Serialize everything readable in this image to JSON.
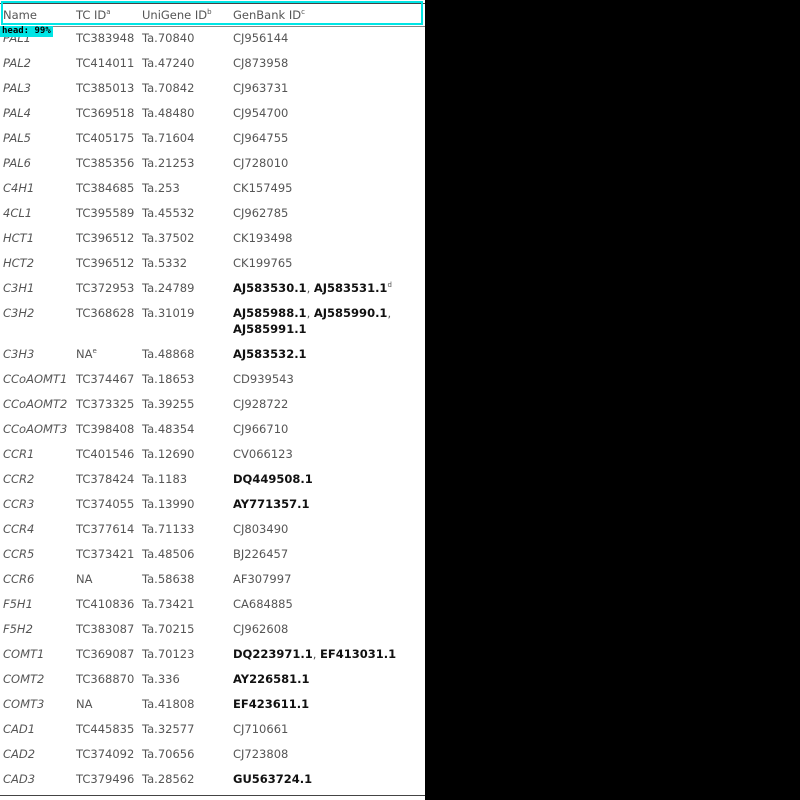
{
  "overlay": {
    "label": "head: 99%"
  },
  "header": {
    "name": "Name",
    "tc": "TC ID",
    "tc_sup": "a",
    "unigene": "UniGene ID",
    "unigene_sup": "b",
    "genbank": "GenBank ID",
    "genbank_sup": "c"
  },
  "rows": [
    {
      "name": "PAL1",
      "tc": "TC383948",
      "unigene": "Ta.70840",
      "genbank": [
        {
          "text": "CJ956144",
          "bold": false
        }
      ]
    },
    {
      "name": "PAL2",
      "tc": "TC414011",
      "unigene": "Ta.47240",
      "genbank": [
        {
          "text": "CJ873958",
          "bold": false
        }
      ]
    },
    {
      "name": "PAL3",
      "tc": "TC385013",
      "unigene": "Ta.70842",
      "genbank": [
        {
          "text": "CJ963731",
          "bold": false
        }
      ]
    },
    {
      "name": "PAL4",
      "tc": "TC369518",
      "unigene": "Ta.48480",
      "genbank": [
        {
          "text": "CJ954700",
          "bold": false
        }
      ]
    },
    {
      "name": "PAL5",
      "tc": "TC405175",
      "unigene": "Ta.71604",
      "genbank": [
        {
          "text": "CJ964755",
          "bold": false
        }
      ]
    },
    {
      "name": "PAL6",
      "tc": "TC385356",
      "unigene": "Ta.21253",
      "genbank": [
        {
          "text": "CJ728010",
          "bold": false
        }
      ]
    },
    {
      "name": "C4H1",
      "tc": "TC384685",
      "unigene": "Ta.253",
      "genbank": [
        {
          "text": "CK157495",
          "bold": false
        }
      ]
    },
    {
      "name": "4CL1",
      "tc": "TC395589",
      "unigene": "Ta.45532",
      "genbank": [
        {
          "text": "CJ962785",
          "bold": false
        }
      ]
    },
    {
      "name": "HCT1",
      "tc": "TC396512",
      "unigene": "Ta.37502",
      "genbank": [
        {
          "text": "CK193498",
          "bold": false
        }
      ]
    },
    {
      "name": "HCT2",
      "tc": "TC396512",
      "unigene": "Ta.5332",
      "genbank": [
        {
          "text": "CK199765",
          "bold": false
        }
      ]
    },
    {
      "name": "C3H1",
      "tc": "TC372953",
      "unigene": "Ta.24789",
      "genbank": [
        {
          "text": "AJ583530.1",
          "bold": true
        },
        {
          "text": ", ",
          "bold": false
        },
        {
          "text": "AJ583531.1",
          "bold": true
        }
      ],
      "genbank_sup": "d"
    },
    {
      "name": "C3H2",
      "tc": "TC368628",
      "unigene": "Ta.31019",
      "genbank": [
        {
          "text": "AJ585988.1",
          "bold": true
        },
        {
          "text": ", ",
          "bold": false
        },
        {
          "text": "AJ585990.1",
          "bold": true
        },
        {
          "text": ",",
          "bold": false
        }
      ],
      "genbank_line2": [
        {
          "text": "AJ585991.1",
          "bold": true
        }
      ]
    },
    {
      "name": "C3H3",
      "tc": "NA",
      "tc_sup": "e",
      "unigene": "Ta.48868",
      "genbank": [
        {
          "text": "AJ583532.1",
          "bold": true
        }
      ]
    },
    {
      "name": "CCoAOMT1",
      "tc": "TC374467",
      "unigene": "Ta.18653",
      "genbank": [
        {
          "text": "CD939543",
          "bold": false
        }
      ]
    },
    {
      "name": "CCoAOMT2",
      "tc": "TC373325",
      "unigene": "Ta.39255",
      "genbank": [
        {
          "text": "CJ928722",
          "bold": false
        }
      ]
    },
    {
      "name": "CCoAOMT3",
      "tc": "TC398408",
      "unigene": "Ta.48354",
      "genbank": [
        {
          "text": "CJ966710",
          "bold": false
        }
      ]
    },
    {
      "name": "CCR1",
      "tc": "TC401546",
      "unigene": "Ta.12690",
      "genbank": [
        {
          "text": "CV066123",
          "bold": false
        }
      ]
    },
    {
      "name": "CCR2",
      "tc": "TC378424",
      "unigene": "Ta.1183",
      "genbank": [
        {
          "text": "DQ449508.1",
          "bold": true
        }
      ]
    },
    {
      "name": "CCR3",
      "tc": "TC374055",
      "unigene": "Ta.13990",
      "genbank": [
        {
          "text": "AY771357.1",
          "bold": true
        }
      ]
    },
    {
      "name": "CCR4",
      "tc": "TC377614",
      "unigene": "Ta.71133",
      "genbank": [
        {
          "text": "CJ803490",
          "bold": false
        }
      ]
    },
    {
      "name": "CCR5",
      "tc": "TC373421",
      "unigene": "Ta.48506",
      "genbank": [
        {
          "text": "BJ226457",
          "bold": false
        }
      ]
    },
    {
      "name": "CCR6",
      "tc": "NA",
      "unigene": "Ta.58638",
      "genbank": [
        {
          "text": "AF307997",
          "bold": false
        }
      ]
    },
    {
      "name": "F5H1",
      "tc": "TC410836",
      "unigene": "Ta.73421",
      "genbank": [
        {
          "text": "CA684885",
          "bold": false
        }
      ]
    },
    {
      "name": "F5H2",
      "tc": "TC383087",
      "unigene": "Ta.70215",
      "genbank": [
        {
          "text": "CJ962608",
          "bold": false
        }
      ]
    },
    {
      "name": "COMT1",
      "tc": "TC369087",
      "unigene": "Ta.70123",
      "genbank": [
        {
          "text": "DQ223971.1",
          "bold": true
        },
        {
          "text": ", ",
          "bold": false
        },
        {
          "text": "EF413031.1",
          "bold": true
        }
      ]
    },
    {
      "name": "COMT2",
      "tc": "TC368870",
      "unigene": "Ta.336",
      "genbank": [
        {
          "text": "AY226581.1",
          "bold": true
        }
      ]
    },
    {
      "name": "COMT3",
      "tc": "NA",
      "unigene": "Ta.41808",
      "genbank": [
        {
          "text": "EF423611.1",
          "bold": true
        }
      ]
    },
    {
      "name": "CAD1",
      "tc": "TC445835",
      "unigene": "Ta.32577",
      "genbank": [
        {
          "text": "CJ710661",
          "bold": false
        }
      ]
    },
    {
      "name": "CAD2",
      "tc": "TC374092",
      "unigene": "Ta.70656",
      "genbank": [
        {
          "text": "CJ723808",
          "bold": false
        }
      ]
    },
    {
      "name": "CAD3",
      "tc": "TC379496",
      "unigene": "Ta.28562",
      "genbank": [
        {
          "text": "GU563724.1",
          "bold": true
        }
      ]
    }
  ]
}
